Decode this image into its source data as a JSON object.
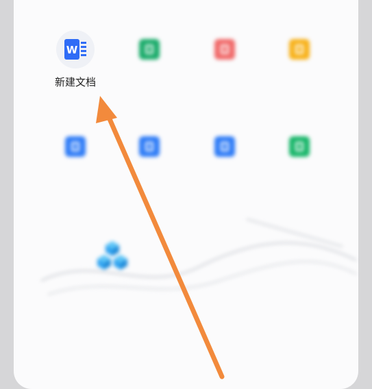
{
  "menu": {
    "items": [
      {
        "label": "新建文档",
        "icon": "word-doc-icon",
        "color": "#2f6cf6"
      },
      {
        "label": "",
        "icon": "spreadsheet-icon",
        "color": "#1aab6a"
      },
      {
        "label": "",
        "icon": "pdf-icon",
        "color": "#f06a6a"
      },
      {
        "label": "",
        "icon": "form-icon",
        "color": "#f7b21c"
      },
      {
        "label": "",
        "icon": "scan-doc-icon",
        "color": "#2f7cf6"
      },
      {
        "label": "",
        "icon": "photo-doc-icon",
        "color": "#2f7cf6"
      },
      {
        "label": "",
        "icon": "text-extract-icon",
        "color": "#2f7cf6"
      },
      {
        "label": "",
        "icon": "green-doc-icon",
        "color": "#19b66a"
      }
    ]
  },
  "banner": {
    "text": "",
    "icon": "template-cubes-icon",
    "color": "#2fa2f0"
  },
  "footer": {
    "cancel_label": ""
  },
  "annotation": {
    "arrow_color": "#f28a3c"
  }
}
